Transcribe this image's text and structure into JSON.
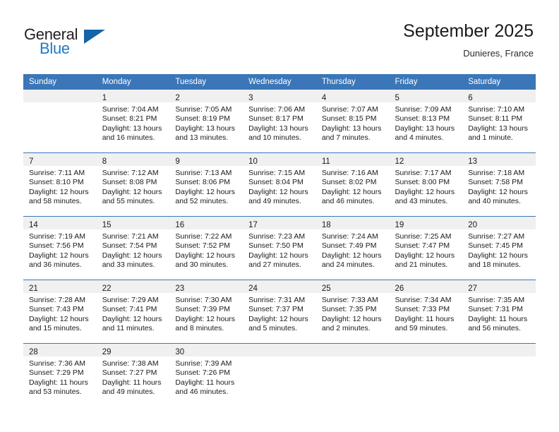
{
  "brand": {
    "name_primary": "General",
    "name_secondary": "Blue",
    "primary_color": "#231f20",
    "secondary_color": "#1f7ac4",
    "triangle_color": "#1663a8"
  },
  "header": {
    "month_title": "September 2025",
    "location": "Dunieres, France"
  },
  "calendar": {
    "header_color": "#3a76b8",
    "daynum_band_color": "#f0f0f0",
    "weekday_headers": [
      "Sunday",
      "Monday",
      "Tuesday",
      "Wednesday",
      "Thursday",
      "Friday",
      "Saturday"
    ],
    "weeks": [
      [
        {
          "day": "",
          "sunrise": "",
          "sunset": "",
          "daylight_line1": "",
          "daylight_line2": "",
          "empty": true
        },
        {
          "day": "1",
          "sunrise": "Sunrise: 7:04 AM",
          "sunset": "Sunset: 8:21 PM",
          "daylight_line1": "Daylight: 13 hours",
          "daylight_line2": "and 16 minutes.",
          "empty": false
        },
        {
          "day": "2",
          "sunrise": "Sunrise: 7:05 AM",
          "sunset": "Sunset: 8:19 PM",
          "daylight_line1": "Daylight: 13 hours",
          "daylight_line2": "and 13 minutes.",
          "empty": false
        },
        {
          "day": "3",
          "sunrise": "Sunrise: 7:06 AM",
          "sunset": "Sunset: 8:17 PM",
          "daylight_line1": "Daylight: 13 hours",
          "daylight_line2": "and 10 minutes.",
          "empty": false
        },
        {
          "day": "4",
          "sunrise": "Sunrise: 7:07 AM",
          "sunset": "Sunset: 8:15 PM",
          "daylight_line1": "Daylight: 13 hours",
          "daylight_line2": "and 7 minutes.",
          "empty": false
        },
        {
          "day": "5",
          "sunrise": "Sunrise: 7:09 AM",
          "sunset": "Sunset: 8:13 PM",
          "daylight_line1": "Daylight: 13 hours",
          "daylight_line2": "and 4 minutes.",
          "empty": false
        },
        {
          "day": "6",
          "sunrise": "Sunrise: 7:10 AM",
          "sunset": "Sunset: 8:11 PM",
          "daylight_line1": "Daylight: 13 hours",
          "daylight_line2": "and 1 minute.",
          "empty": false
        }
      ],
      [
        {
          "day": "7",
          "sunrise": "Sunrise: 7:11 AM",
          "sunset": "Sunset: 8:10 PM",
          "daylight_line1": "Daylight: 12 hours",
          "daylight_line2": "and 58 minutes.",
          "empty": false
        },
        {
          "day": "8",
          "sunrise": "Sunrise: 7:12 AM",
          "sunset": "Sunset: 8:08 PM",
          "daylight_line1": "Daylight: 12 hours",
          "daylight_line2": "and 55 minutes.",
          "empty": false
        },
        {
          "day": "9",
          "sunrise": "Sunrise: 7:13 AM",
          "sunset": "Sunset: 8:06 PM",
          "daylight_line1": "Daylight: 12 hours",
          "daylight_line2": "and 52 minutes.",
          "empty": false
        },
        {
          "day": "10",
          "sunrise": "Sunrise: 7:15 AM",
          "sunset": "Sunset: 8:04 PM",
          "daylight_line1": "Daylight: 12 hours",
          "daylight_line2": "and 49 minutes.",
          "empty": false
        },
        {
          "day": "11",
          "sunrise": "Sunrise: 7:16 AM",
          "sunset": "Sunset: 8:02 PM",
          "daylight_line1": "Daylight: 12 hours",
          "daylight_line2": "and 46 minutes.",
          "empty": false
        },
        {
          "day": "12",
          "sunrise": "Sunrise: 7:17 AM",
          "sunset": "Sunset: 8:00 PM",
          "daylight_line1": "Daylight: 12 hours",
          "daylight_line2": "and 43 minutes.",
          "empty": false
        },
        {
          "day": "13",
          "sunrise": "Sunrise: 7:18 AM",
          "sunset": "Sunset: 7:58 PM",
          "daylight_line1": "Daylight: 12 hours",
          "daylight_line2": "and 40 minutes.",
          "empty": false
        }
      ],
      [
        {
          "day": "14",
          "sunrise": "Sunrise: 7:19 AM",
          "sunset": "Sunset: 7:56 PM",
          "daylight_line1": "Daylight: 12 hours",
          "daylight_line2": "and 36 minutes.",
          "empty": false
        },
        {
          "day": "15",
          "sunrise": "Sunrise: 7:21 AM",
          "sunset": "Sunset: 7:54 PM",
          "daylight_line1": "Daylight: 12 hours",
          "daylight_line2": "and 33 minutes.",
          "empty": false
        },
        {
          "day": "16",
          "sunrise": "Sunrise: 7:22 AM",
          "sunset": "Sunset: 7:52 PM",
          "daylight_line1": "Daylight: 12 hours",
          "daylight_line2": "and 30 minutes.",
          "empty": false
        },
        {
          "day": "17",
          "sunrise": "Sunrise: 7:23 AM",
          "sunset": "Sunset: 7:50 PM",
          "daylight_line1": "Daylight: 12 hours",
          "daylight_line2": "and 27 minutes.",
          "empty": false
        },
        {
          "day": "18",
          "sunrise": "Sunrise: 7:24 AM",
          "sunset": "Sunset: 7:49 PM",
          "daylight_line1": "Daylight: 12 hours",
          "daylight_line2": "and 24 minutes.",
          "empty": false
        },
        {
          "day": "19",
          "sunrise": "Sunrise: 7:25 AM",
          "sunset": "Sunset: 7:47 PM",
          "daylight_line1": "Daylight: 12 hours",
          "daylight_line2": "and 21 minutes.",
          "empty": false
        },
        {
          "day": "20",
          "sunrise": "Sunrise: 7:27 AM",
          "sunset": "Sunset: 7:45 PM",
          "daylight_line1": "Daylight: 12 hours",
          "daylight_line2": "and 18 minutes.",
          "empty": false
        }
      ],
      [
        {
          "day": "21",
          "sunrise": "Sunrise: 7:28 AM",
          "sunset": "Sunset: 7:43 PM",
          "daylight_line1": "Daylight: 12 hours",
          "daylight_line2": "and 15 minutes.",
          "empty": false
        },
        {
          "day": "22",
          "sunrise": "Sunrise: 7:29 AM",
          "sunset": "Sunset: 7:41 PM",
          "daylight_line1": "Daylight: 12 hours",
          "daylight_line2": "and 11 minutes.",
          "empty": false
        },
        {
          "day": "23",
          "sunrise": "Sunrise: 7:30 AM",
          "sunset": "Sunset: 7:39 PM",
          "daylight_line1": "Daylight: 12 hours",
          "daylight_line2": "and 8 minutes.",
          "empty": false
        },
        {
          "day": "24",
          "sunrise": "Sunrise: 7:31 AM",
          "sunset": "Sunset: 7:37 PM",
          "daylight_line1": "Daylight: 12 hours",
          "daylight_line2": "and 5 minutes.",
          "empty": false
        },
        {
          "day": "25",
          "sunrise": "Sunrise: 7:33 AM",
          "sunset": "Sunset: 7:35 PM",
          "daylight_line1": "Daylight: 12 hours",
          "daylight_line2": "and 2 minutes.",
          "empty": false
        },
        {
          "day": "26",
          "sunrise": "Sunrise: 7:34 AM",
          "sunset": "Sunset: 7:33 PM",
          "daylight_line1": "Daylight: 11 hours",
          "daylight_line2": "and 59 minutes.",
          "empty": false
        },
        {
          "day": "27",
          "sunrise": "Sunrise: 7:35 AM",
          "sunset": "Sunset: 7:31 PM",
          "daylight_line1": "Daylight: 11 hours",
          "daylight_line2": "and 56 minutes.",
          "empty": false
        }
      ],
      [
        {
          "day": "28",
          "sunrise": "Sunrise: 7:36 AM",
          "sunset": "Sunset: 7:29 PM",
          "daylight_line1": "Daylight: 11 hours",
          "daylight_line2": "and 53 minutes.",
          "empty": false
        },
        {
          "day": "29",
          "sunrise": "Sunrise: 7:38 AM",
          "sunset": "Sunset: 7:27 PM",
          "daylight_line1": "Daylight: 11 hours",
          "daylight_line2": "and 49 minutes.",
          "empty": false
        },
        {
          "day": "30",
          "sunrise": "Sunrise: 7:39 AM",
          "sunset": "Sunset: 7:26 PM",
          "daylight_line1": "Daylight: 11 hours",
          "daylight_line2": "and 46 minutes.",
          "empty": false
        },
        {
          "day": "",
          "sunrise": "",
          "sunset": "",
          "daylight_line1": "",
          "daylight_line2": "",
          "empty": true
        },
        {
          "day": "",
          "sunrise": "",
          "sunset": "",
          "daylight_line1": "",
          "daylight_line2": "",
          "empty": true
        },
        {
          "day": "",
          "sunrise": "",
          "sunset": "",
          "daylight_line1": "",
          "daylight_line2": "",
          "empty": true
        },
        {
          "day": "",
          "sunrise": "",
          "sunset": "",
          "daylight_line1": "",
          "daylight_line2": "",
          "empty": true
        }
      ]
    ]
  }
}
